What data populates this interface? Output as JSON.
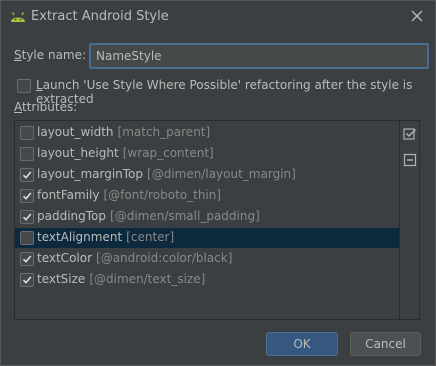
{
  "window": {
    "title": "Extract Android Style",
    "icon": "android-icon"
  },
  "style_name": {
    "label_prefix": "S",
    "label_rest": "tyle name:",
    "value": "NameStyle"
  },
  "launch_refactoring": {
    "checked": false,
    "label_prefix": "L",
    "label_rest": "aunch 'Use Style Where Possible' refactoring after the style is extracted"
  },
  "attributes": {
    "label_prefix": "A",
    "label_rest": "ttributes:",
    "items": [
      {
        "name": "layout_width",
        "value": "[match_parent]",
        "checked": false,
        "selected": false
      },
      {
        "name": "layout_height",
        "value": "[wrap_content]",
        "checked": false,
        "selected": false
      },
      {
        "name": "layout_marginTop",
        "value": "[@dimen/layout_margin]",
        "checked": true,
        "selected": false
      },
      {
        "name": "fontFamily",
        "value": "[@font/roboto_thin]",
        "checked": true,
        "selected": false
      },
      {
        "name": "paddingTop",
        "value": "[@dimen/small_padding]",
        "checked": true,
        "selected": false
      },
      {
        "name": "textAlignment",
        "value": "[center]",
        "checked": false,
        "selected": true
      },
      {
        "name": "textColor",
        "value": "[@android:color/black]",
        "checked": true,
        "selected": false
      },
      {
        "name": "textSize",
        "value": "[@dimen/text_size]",
        "checked": true,
        "selected": false
      }
    ],
    "side_icons": [
      "select-all-icon",
      "unselect-all-icon"
    ]
  },
  "buttons": {
    "ok": "OK",
    "cancel": "Cancel"
  },
  "colors": {
    "background": "#3c3f41",
    "accent": "#365880",
    "selection": "#0d293e",
    "android_green": "#a4c639"
  }
}
